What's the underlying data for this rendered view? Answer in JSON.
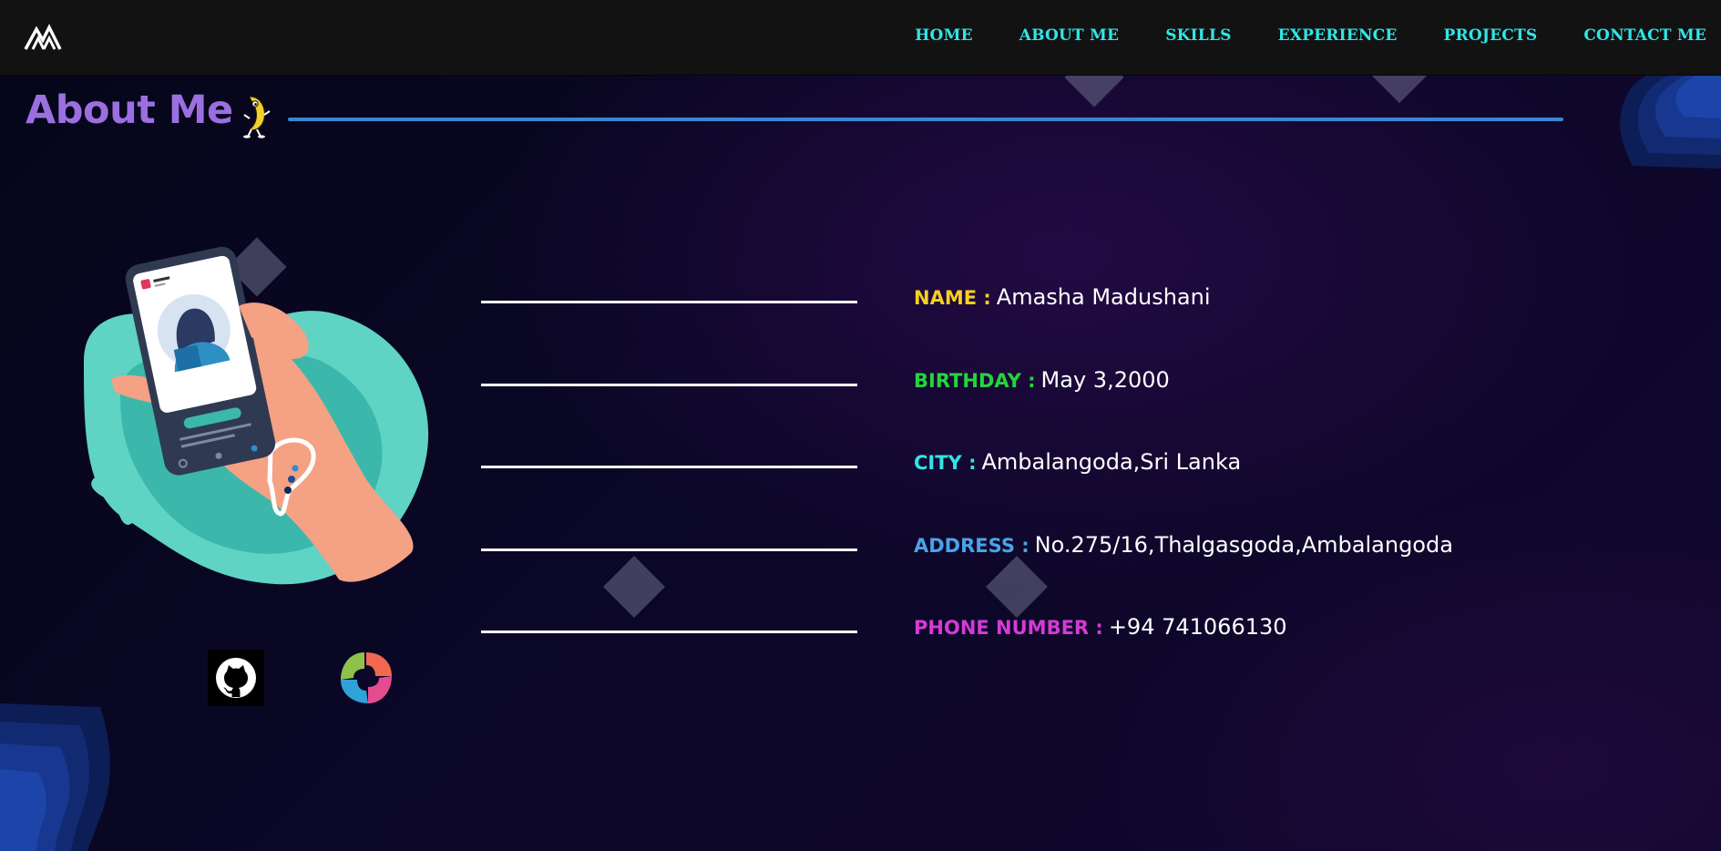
{
  "nav": {
    "items": [
      {
        "label": "HOME"
      },
      {
        "label": "ABOUT ME"
      },
      {
        "label": "SKILLS"
      },
      {
        "label": "EXPERIENCE"
      },
      {
        "label": "PROJECTS"
      },
      {
        "label": "CONTACT ME"
      }
    ]
  },
  "section": {
    "title": "About Me"
  },
  "details": [
    {
      "label": "NAME :",
      "value": "Amasha Madushani",
      "color": "#f5d020"
    },
    {
      "label": "BIRTHDAY :",
      "value": "May 3,2000",
      "color": "#22d63a"
    },
    {
      "label": "CITY :",
      "value": "Ambalangoda,Sri Lanka",
      "color": "#2ee6e8"
    },
    {
      "label": "ADDRESS :",
      "value": "No.275/16,Thalgasgoda,Ambalangoda",
      "color": "#4aa3e8"
    },
    {
      "label": "PHONE NUMBER :",
      "value": "+94 741066130",
      "color": "#d63ad6"
    }
  ],
  "social": {
    "github_icon": "github-icon",
    "sololearn_icon": "sololearn-icon"
  },
  "colors": {
    "accent_title": "#9b6fe0",
    "nav_link": "#2ee6e8",
    "title_line": "#3a86d4"
  }
}
